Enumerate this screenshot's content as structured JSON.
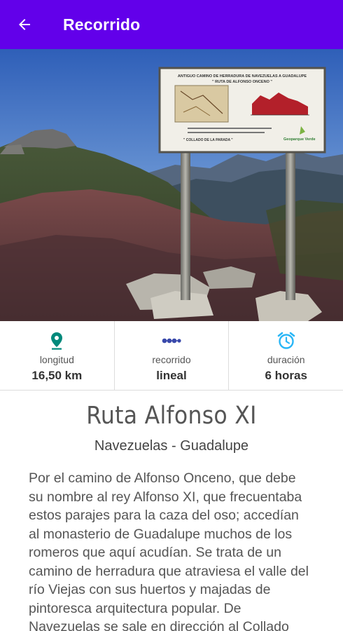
{
  "appbar": {
    "title": "Recorrido",
    "back_icon": "arrow-back-icon",
    "color": "#6200ea"
  },
  "hero": {
    "sign_title": "ANTIGUO CAMINO DE HERRADURA DE NAVEZUELAS A GUADALUPE",
    "sign_subtitle": "\" RUTA DE ALFONSO ONCENO \"",
    "sign_footer": "\" COLLADO DE LA PARADA \"",
    "sign_brand": "Geoparque Verde"
  },
  "stats": [
    {
      "icon": "map-pin-icon",
      "label": "longitud",
      "value": "16,50 km",
      "color": "#00897b"
    },
    {
      "icon": "route-dots-icon",
      "label": "recorrido",
      "value": "lineal",
      "color": "#3949ab"
    },
    {
      "icon": "alarm-clock-icon",
      "label": "duración",
      "value": "6 horas",
      "color": "#29b6f6"
    }
  ],
  "route": {
    "title": "Ruta Alfonso XI",
    "subtitle": "Navezuelas - Guadalupe",
    "description": "Por el camino de Alfonso Onceno, que debe su nombre al rey Alfonso XI, que frecuentaba estos parajes para la caza del oso; accedían al monasterio de Guadalupe muchos de los romeros que aquí acudían. Se trata de un camino de herradura que atraviesa el valle del río Viejas con sus huertos y majadas de pintoresca arquitectura popular. De Navezuelas se sale en dirección al Collado"
  }
}
